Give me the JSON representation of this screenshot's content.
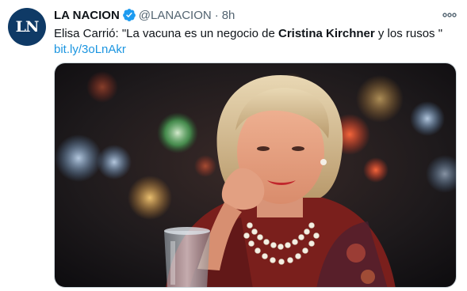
{
  "tweet": {
    "account_name": "LA NACION",
    "handle": "@LANACION",
    "separator": "·",
    "time": "8h",
    "avatar_initials": "LN",
    "text_before": "Elisa Carrió: \"La vacuna es un negocio de ",
    "text_bold": "Cristina Kirchner",
    "text_after": " y los rusos \"",
    "link": "bit.ly/3oLnAkr",
    "verified_icon": "verified-badge-icon",
    "more_icon": "more-options-icon",
    "media_alt": "photo-of-woman-with-pearl-necklace"
  },
  "colors": {
    "link": "#1b95e0",
    "verified": "#1d9bf0",
    "avatar_bg": "#0f3a66",
    "muted": "#536471"
  }
}
